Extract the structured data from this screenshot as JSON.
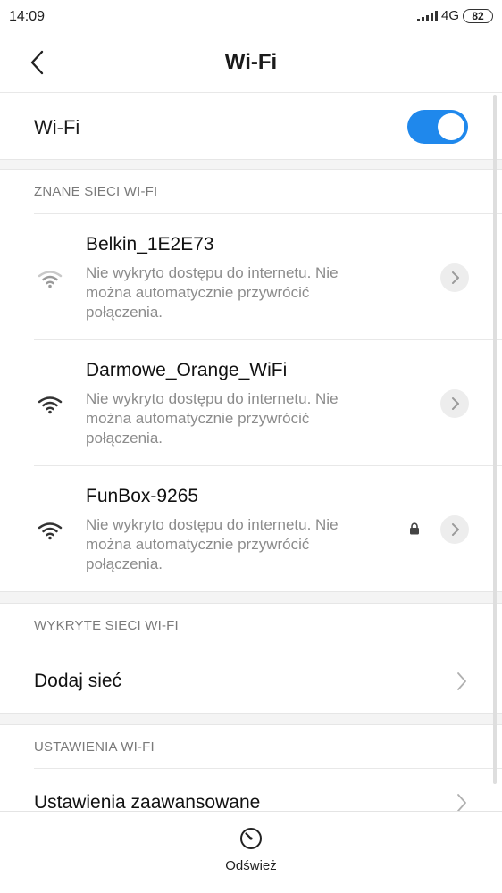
{
  "status_bar": {
    "time": "14:09",
    "network": "4G",
    "battery": "82"
  },
  "header": {
    "title": "Wi-Fi"
  },
  "wifi_toggle": {
    "label": "Wi-Fi",
    "enabled": true
  },
  "known_networks": {
    "header": "ZNANE SIECI WI-FI",
    "items": [
      {
        "name": "Belkin_1E2E73",
        "status": "Nie wykryto dostępu do internetu. Nie można automatycznie przywrócić połączenia.",
        "secured": false
      },
      {
        "name": "Darmowe_Orange_WiFi",
        "status": "Nie wykryto dostępu do internetu. Nie można automatycznie przywrócić połączenia.",
        "secured": false
      },
      {
        "name": "FunBox-9265",
        "status": "Nie wykryto dostępu do internetu. Nie można automatycznie przywrócić połączenia.",
        "secured": true
      }
    ]
  },
  "detected_networks": {
    "header": "WYKRYTE SIECI WI-FI",
    "add_network_label": "Dodaj sieć"
  },
  "wifi_settings": {
    "header": "USTAWIENIA WI-FI",
    "advanced_label": "Ustawienia zaawansowane"
  },
  "bottom_bar": {
    "refresh_label": "Odśwież"
  },
  "colors": {
    "accent": "#1f88ec",
    "section_text": "#7a7a7a",
    "secondary_text": "#8c8c8c"
  }
}
